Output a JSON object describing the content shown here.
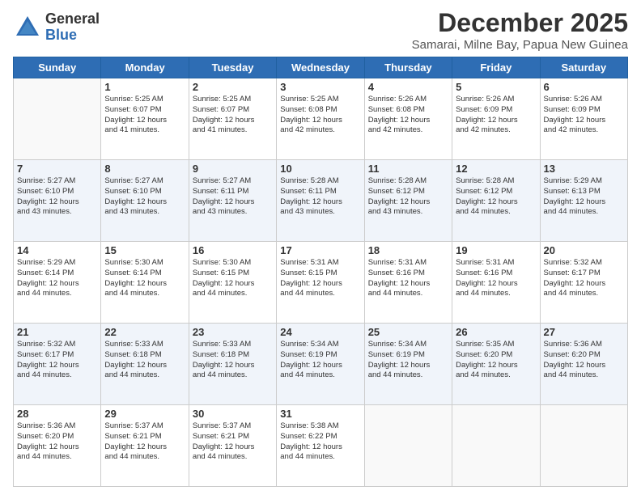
{
  "logo": {
    "general": "General",
    "blue": "Blue"
  },
  "title": "December 2025",
  "subtitle": "Samarai, Milne Bay, Papua New Guinea",
  "days_of_week": [
    "Sunday",
    "Monday",
    "Tuesday",
    "Wednesday",
    "Thursday",
    "Friday",
    "Saturday"
  ],
  "weeks": [
    [
      {
        "day": "",
        "info": ""
      },
      {
        "day": "1",
        "info": "Sunrise: 5:25 AM\nSunset: 6:07 PM\nDaylight: 12 hours\nand 41 minutes."
      },
      {
        "day": "2",
        "info": "Sunrise: 5:25 AM\nSunset: 6:07 PM\nDaylight: 12 hours\nand 41 minutes."
      },
      {
        "day": "3",
        "info": "Sunrise: 5:25 AM\nSunset: 6:08 PM\nDaylight: 12 hours\nand 42 minutes."
      },
      {
        "day": "4",
        "info": "Sunrise: 5:26 AM\nSunset: 6:08 PM\nDaylight: 12 hours\nand 42 minutes."
      },
      {
        "day": "5",
        "info": "Sunrise: 5:26 AM\nSunset: 6:09 PM\nDaylight: 12 hours\nand 42 minutes."
      },
      {
        "day": "6",
        "info": "Sunrise: 5:26 AM\nSunset: 6:09 PM\nDaylight: 12 hours\nand 42 minutes."
      }
    ],
    [
      {
        "day": "7",
        "info": "Sunrise: 5:27 AM\nSunset: 6:10 PM\nDaylight: 12 hours\nand 43 minutes."
      },
      {
        "day": "8",
        "info": "Sunrise: 5:27 AM\nSunset: 6:10 PM\nDaylight: 12 hours\nand 43 minutes."
      },
      {
        "day": "9",
        "info": "Sunrise: 5:27 AM\nSunset: 6:11 PM\nDaylight: 12 hours\nand 43 minutes."
      },
      {
        "day": "10",
        "info": "Sunrise: 5:28 AM\nSunset: 6:11 PM\nDaylight: 12 hours\nand 43 minutes."
      },
      {
        "day": "11",
        "info": "Sunrise: 5:28 AM\nSunset: 6:12 PM\nDaylight: 12 hours\nand 43 minutes."
      },
      {
        "day": "12",
        "info": "Sunrise: 5:28 AM\nSunset: 6:12 PM\nDaylight: 12 hours\nand 44 minutes."
      },
      {
        "day": "13",
        "info": "Sunrise: 5:29 AM\nSunset: 6:13 PM\nDaylight: 12 hours\nand 44 minutes."
      }
    ],
    [
      {
        "day": "14",
        "info": "Sunrise: 5:29 AM\nSunset: 6:14 PM\nDaylight: 12 hours\nand 44 minutes."
      },
      {
        "day": "15",
        "info": "Sunrise: 5:30 AM\nSunset: 6:14 PM\nDaylight: 12 hours\nand 44 minutes."
      },
      {
        "day": "16",
        "info": "Sunrise: 5:30 AM\nSunset: 6:15 PM\nDaylight: 12 hours\nand 44 minutes."
      },
      {
        "day": "17",
        "info": "Sunrise: 5:31 AM\nSunset: 6:15 PM\nDaylight: 12 hours\nand 44 minutes."
      },
      {
        "day": "18",
        "info": "Sunrise: 5:31 AM\nSunset: 6:16 PM\nDaylight: 12 hours\nand 44 minutes."
      },
      {
        "day": "19",
        "info": "Sunrise: 5:31 AM\nSunset: 6:16 PM\nDaylight: 12 hours\nand 44 minutes."
      },
      {
        "day": "20",
        "info": "Sunrise: 5:32 AM\nSunset: 6:17 PM\nDaylight: 12 hours\nand 44 minutes."
      }
    ],
    [
      {
        "day": "21",
        "info": "Sunrise: 5:32 AM\nSunset: 6:17 PM\nDaylight: 12 hours\nand 44 minutes."
      },
      {
        "day": "22",
        "info": "Sunrise: 5:33 AM\nSunset: 6:18 PM\nDaylight: 12 hours\nand 44 minutes."
      },
      {
        "day": "23",
        "info": "Sunrise: 5:33 AM\nSunset: 6:18 PM\nDaylight: 12 hours\nand 44 minutes."
      },
      {
        "day": "24",
        "info": "Sunrise: 5:34 AM\nSunset: 6:19 PM\nDaylight: 12 hours\nand 44 minutes."
      },
      {
        "day": "25",
        "info": "Sunrise: 5:34 AM\nSunset: 6:19 PM\nDaylight: 12 hours\nand 44 minutes."
      },
      {
        "day": "26",
        "info": "Sunrise: 5:35 AM\nSunset: 6:20 PM\nDaylight: 12 hours\nand 44 minutes."
      },
      {
        "day": "27",
        "info": "Sunrise: 5:36 AM\nSunset: 6:20 PM\nDaylight: 12 hours\nand 44 minutes."
      }
    ],
    [
      {
        "day": "28",
        "info": "Sunrise: 5:36 AM\nSunset: 6:20 PM\nDaylight: 12 hours\nand 44 minutes."
      },
      {
        "day": "29",
        "info": "Sunrise: 5:37 AM\nSunset: 6:21 PM\nDaylight: 12 hours\nand 44 minutes."
      },
      {
        "day": "30",
        "info": "Sunrise: 5:37 AM\nSunset: 6:21 PM\nDaylight: 12 hours\nand 44 minutes."
      },
      {
        "day": "31",
        "info": "Sunrise: 5:38 AM\nSunset: 6:22 PM\nDaylight: 12 hours\nand 44 minutes."
      },
      {
        "day": "",
        "info": ""
      },
      {
        "day": "",
        "info": ""
      },
      {
        "day": "",
        "info": ""
      }
    ]
  ]
}
